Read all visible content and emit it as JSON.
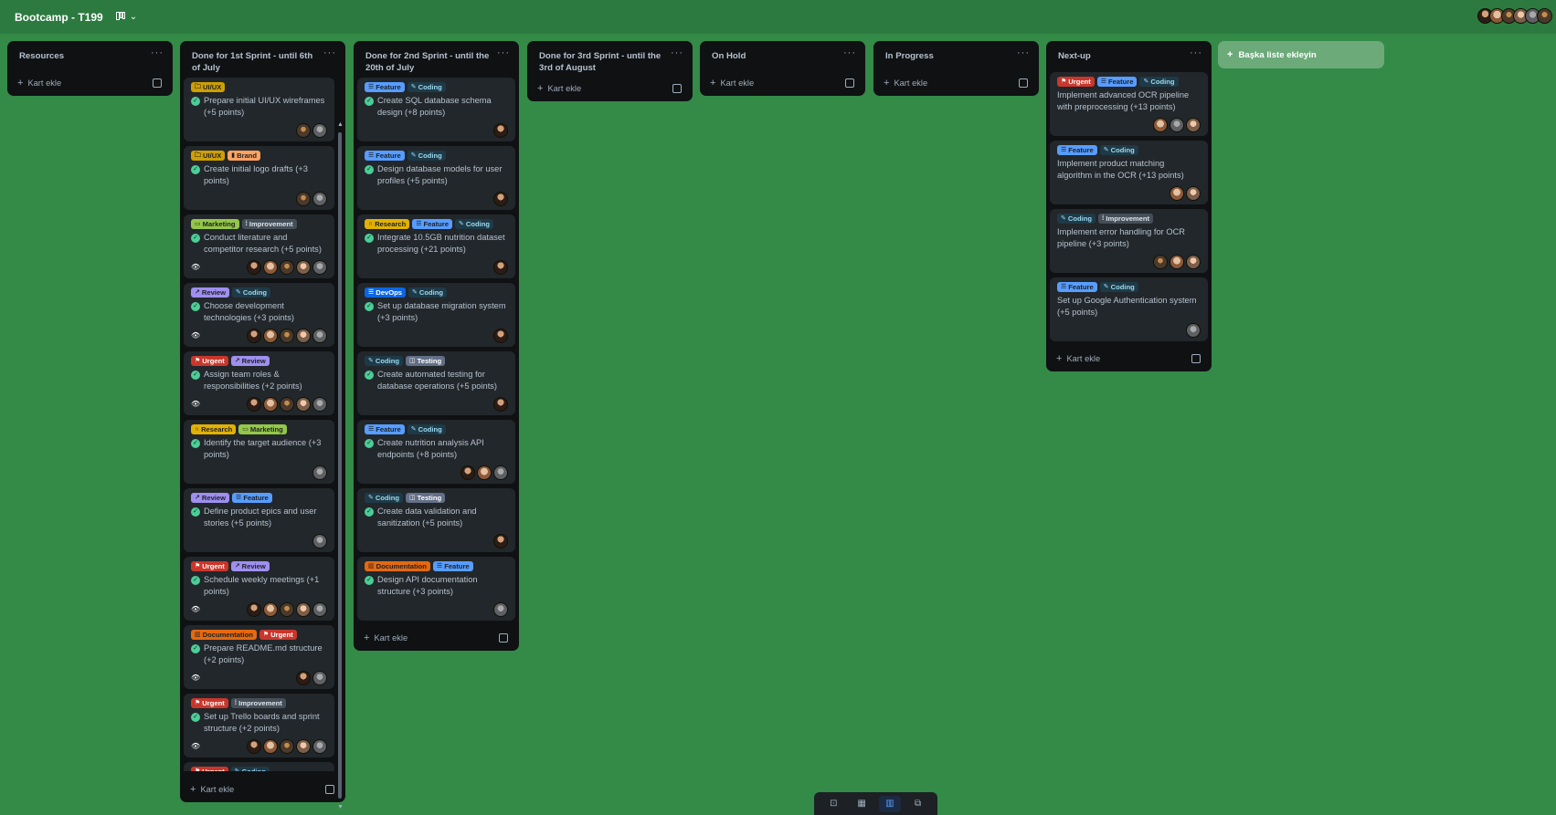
{
  "board": {
    "title": "Bootcamp - T199",
    "view_icon": "board-view-icon",
    "chevron": "⌄"
  },
  "header_avatars": [
    0,
    1,
    2,
    3,
    4,
    2
  ],
  "label_styles": {
    "UI/UX": {
      "bg": "#cf9f02",
      "fg": "#1d2125",
      "icon": "🗀"
    },
    "Brand": {
      "bg": "#fea362",
      "fg": "#1d2125",
      "icon": "▮"
    },
    "Marketing": {
      "bg": "#94c748",
      "fg": "#1d2125",
      "icon": "▭"
    },
    "Improvement": {
      "bg": "#454f59",
      "fg": "#dee4ea",
      "icon": "⁞"
    },
    "Review": {
      "bg": "#9f8fef",
      "fg": "#1d2125",
      "icon": "↗"
    },
    "Coding": {
      "bg": "#1e3a48",
      "fg": "#9dd9ee",
      "icon": "✎"
    },
    "Urgent": {
      "bg": "#c9372c",
      "fg": "#ffffff",
      "icon": "⚑"
    },
    "Research": {
      "bg": "#e2b203",
      "fg": "#1d2125",
      "icon": "∩"
    },
    "Feature": {
      "bg": "#579dff",
      "fg": "#1d2125",
      "icon": "☰"
    },
    "Documentation": {
      "bg": "#e56910",
      "fg": "#1d2125",
      "icon": "▥"
    },
    "DevOps": {
      "bg": "#0c66e4",
      "fg": "#ffffff",
      "icon": "☰"
    },
    "Testing": {
      "bg": "#626f86",
      "fg": "#ffffff",
      "icon": "◫"
    }
  },
  "lists": [
    {
      "id": "resources",
      "title": "Resources",
      "menu": "···",
      "add_label": "Kart ekle",
      "cards": []
    },
    {
      "id": "sprint1",
      "title": "Done for 1st Sprint - until 6th of July",
      "menu": "···",
      "add_label": "Kart ekle",
      "cards": [
        {
          "labels": [
            "UI/UX"
          ],
          "title": "Prepare initial UI/UX wireframes (+5 points)",
          "done": true,
          "watch": false,
          "members": [
            2,
            4
          ]
        },
        {
          "labels": [
            "UI/UX",
            "Brand"
          ],
          "title": "Create initial logo drafts (+3 points)",
          "done": true,
          "watch": false,
          "members": [
            2,
            4
          ]
        },
        {
          "labels": [
            "Marketing",
            "Improvement"
          ],
          "title": "Conduct literature and competitor research (+5 points)",
          "done": true,
          "watch": true,
          "members": [
            0,
            1,
            2,
            3,
            4
          ]
        },
        {
          "labels": [
            "Review",
            "Coding"
          ],
          "title": "Choose development technologies (+3 points)",
          "done": true,
          "watch": true,
          "members": [
            0,
            1,
            2,
            3,
            4
          ]
        },
        {
          "labels": [
            "Urgent",
            "Review"
          ],
          "title": "Assign team roles & responsibilities (+2 points)",
          "done": true,
          "watch": true,
          "members": [
            0,
            1,
            2,
            3,
            4
          ]
        },
        {
          "labels": [
            "Research",
            "Marketing"
          ],
          "title": "Identify the target audience (+3 points)",
          "done": true,
          "watch": false,
          "members": [
            4
          ]
        },
        {
          "labels": [
            "Review",
            "Feature"
          ],
          "title": "Define product epics and user stories (+5 points)",
          "done": true,
          "watch": false,
          "members": [
            4
          ]
        },
        {
          "labels": [
            "Urgent",
            "Review"
          ],
          "title": "Schedule weekly meetings (+1 points)",
          "done": true,
          "watch": true,
          "members": [
            0,
            1,
            2,
            3,
            4
          ]
        },
        {
          "labels": [
            "Documentation",
            "Urgent"
          ],
          "title": "Prepare README.md structure (+2 points)",
          "done": true,
          "watch": true,
          "members": [
            0,
            4
          ]
        },
        {
          "labels": [
            "Urgent",
            "Improvement"
          ],
          "title": "Set up Trello boards and sprint structure (+2 points)",
          "done": true,
          "watch": true,
          "members": [
            0,
            1,
            2,
            3,
            4
          ]
        },
        {
          "labels": [
            "Urgent",
            "Coding"
          ],
          "title": "",
          "done": false,
          "watch": false,
          "members": []
        }
      ]
    },
    {
      "id": "sprint2",
      "title": "Done for 2nd Sprint - until the 20th of July",
      "menu": "···",
      "add_label": "Kart ekle",
      "cards": [
        {
          "labels": [
            "Feature",
            "Coding"
          ],
          "title": "Create SQL database schema design (+8 points)",
          "done": true,
          "watch": false,
          "members": [
            0
          ]
        },
        {
          "labels": [
            "Feature",
            "Coding"
          ],
          "title": "Design database models for user profiles (+5 points)",
          "done": true,
          "watch": false,
          "members": [
            0
          ]
        },
        {
          "labels": [
            "Research",
            "Feature",
            "Coding"
          ],
          "title": "Integrate 10.5GB nutrition dataset processing (+21 points)",
          "done": true,
          "watch": false,
          "members": [
            0
          ]
        },
        {
          "labels": [
            "DevOps",
            "Coding"
          ],
          "title": "Set up database migration system (+3 points)",
          "done": true,
          "watch": false,
          "members": [
            0
          ]
        },
        {
          "labels": [
            "Coding",
            "Testing"
          ],
          "title": "Create automated testing for database operations (+5 points)",
          "done": true,
          "watch": false,
          "members": [
            0
          ]
        },
        {
          "labels": [
            "Feature",
            "Coding"
          ],
          "title": "Create nutrition analysis API endpoints (+8 points)",
          "done": true,
          "watch": false,
          "members": [
            0,
            1,
            4
          ]
        },
        {
          "labels": [
            "Coding",
            "Testing"
          ],
          "title": "Create data validation and sanitization (+5 points)",
          "done": true,
          "watch": false,
          "members": [
            0
          ]
        },
        {
          "labels": [
            "Documentation",
            "Feature"
          ],
          "title": "Design API documentation structure (+3 points)",
          "done": true,
          "watch": false,
          "members": [
            4
          ]
        }
      ]
    },
    {
      "id": "sprint3",
      "title": "Done for 3rd Sprint - until the 3rd of August",
      "menu": "···",
      "add_label": "Kart ekle",
      "cards": []
    },
    {
      "id": "onhold",
      "title": "On Hold",
      "menu": "···",
      "add_label": "Kart ekle",
      "cards": []
    },
    {
      "id": "inprogress",
      "title": "In Progress",
      "menu": "···",
      "add_label": "Kart ekle",
      "cards": []
    },
    {
      "id": "nextup",
      "title": "Next-up",
      "menu": "···",
      "add_label": "Kart ekle",
      "cards": [
        {
          "labels": [
            "Urgent",
            "Feature",
            "Coding"
          ],
          "title": "Implement advanced OCR pipeline with preprocessing (+13 points)",
          "done": false,
          "watch": false,
          "members": [
            1,
            4,
            3
          ]
        },
        {
          "labels": [
            "Feature",
            "Coding"
          ],
          "title": "Implement product matching algorithm in the OCR (+13 points)",
          "done": false,
          "watch": false,
          "members": [
            1,
            3
          ]
        },
        {
          "labels": [
            "Coding",
            "Improvement"
          ],
          "title": "Implement error handling for OCR pipeline (+3 points)",
          "done": false,
          "watch": false,
          "members": [
            2,
            1,
            3
          ]
        },
        {
          "labels": [
            "Feature",
            "Coding"
          ],
          "title": "Set up Google Authentication system (+5 points)",
          "done": false,
          "watch": false,
          "members": [
            4
          ]
        }
      ]
    }
  ],
  "add_list_label": "Başka liste ekleyin",
  "dock": [
    {
      "name": "inbox-icon",
      "glyph": "⊡",
      "active": false
    },
    {
      "name": "calendar-icon",
      "glyph": "▦",
      "active": false
    },
    {
      "name": "board-icon",
      "glyph": "▥",
      "active": true
    },
    {
      "name": "switch-boards-icon",
      "glyph": "⧉",
      "active": false
    }
  ]
}
